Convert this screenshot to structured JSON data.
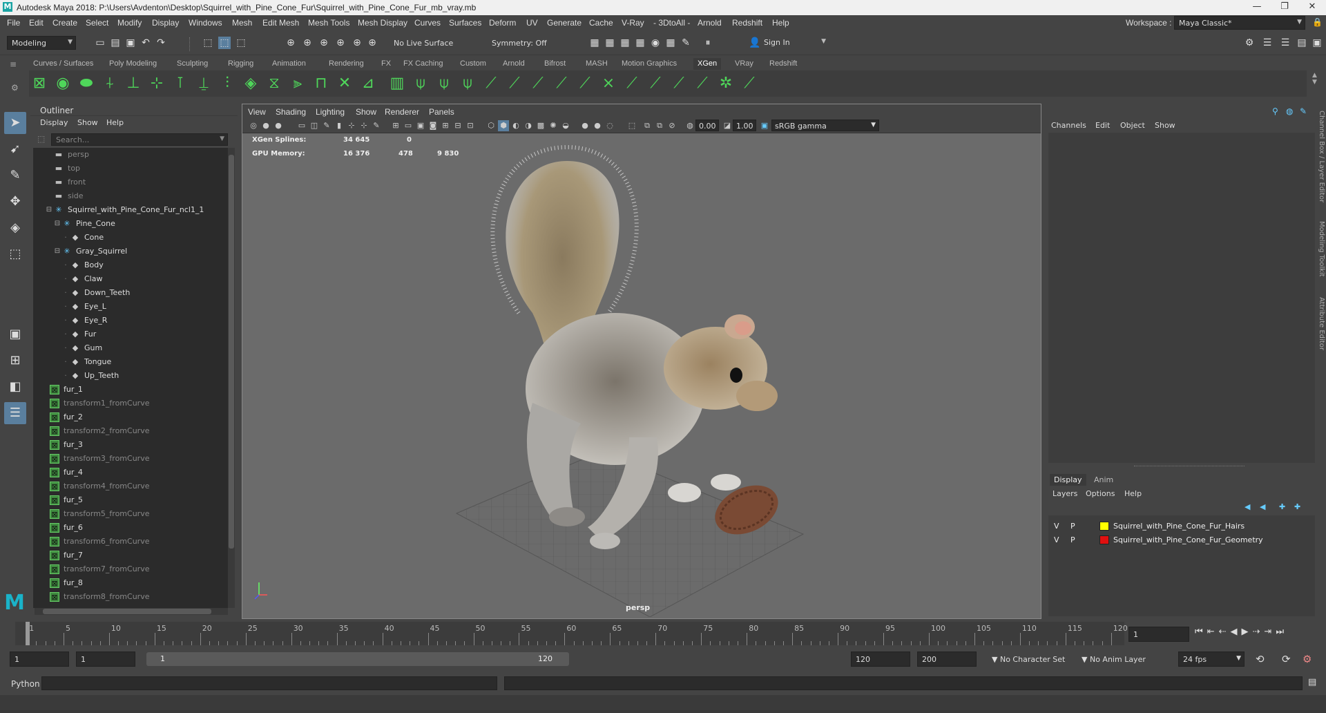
{
  "window": {
    "title": "Autodesk Maya 2018: P:\\Users\\Avdenton\\Desktop\\Squirrel_with_Pine_Cone_Fur\\Squirrel_with_Pine_Cone_Fur_mb_vray.mb",
    "logo": "M",
    "controls": {
      "minimize": "—",
      "maximize": "❐",
      "close": "✕"
    }
  },
  "menubar": {
    "items": [
      "File",
      "Edit",
      "Create",
      "Select",
      "Modify",
      "Display",
      "Windows",
      "Mesh",
      "Edit Mesh",
      "Mesh Tools",
      "Mesh Display",
      "Curves",
      "Surfaces",
      "Deform",
      "UV",
      "Generate",
      "Cache",
      "V-Ray",
      "- 3DtoAll -",
      "Arnold",
      "Redshift",
      "Help"
    ],
    "workspace_label": "Workspace :",
    "workspace_value": "Maya Classic*"
  },
  "statusline": {
    "menuset": "Modeling",
    "live_surface": "No Live Surface",
    "symmetry": "Symmetry: Off",
    "sign_in": "Sign In"
  },
  "shelf": {
    "tabs": [
      "Curves / Surfaces",
      "Poly Modeling",
      "Sculpting",
      "Rigging",
      "Animation",
      "Rendering",
      "FX",
      "FX Caching",
      "Custom",
      "Arnold",
      "Bifrost",
      "MASH",
      "Motion Graphics",
      "XGen",
      "VRay",
      "Redshift"
    ],
    "active_tab": "XGen",
    "icons": [
      "xgen-create-icon",
      "xgen-editor-icon",
      "xgen-sphere-icon",
      "place-guides-icon",
      "guide-add-icon",
      "guide-length-icon",
      "guide-tube-icon",
      "guide-lock-icon",
      "guide-sculpt-icon",
      "guide-layers-icon",
      "guide-bend-icon",
      "guide-clump-icon",
      "guide-cut-icon",
      "guide-smooth-icon",
      "guide-move-icon",
      "xgen-preview-icon",
      "interactive-groom-icon",
      "groom-place-icon",
      "groom-length-icon",
      "groom-comb-icon",
      "groom-grab-icon",
      "groom-cut-icon",
      "groom-smooth-icon",
      "groom-noise-icon",
      "groom-part-icon",
      "groom-clump-icon",
      "groom-freeze-icon",
      "groom-select-icon",
      "groom-density-icon",
      "groom-width-icon",
      "groom-mask-icon"
    ]
  },
  "outliner": {
    "title": "Outliner",
    "menus": [
      "Display",
      "Show",
      "Help"
    ],
    "search_placeholder": "Search...",
    "items": [
      {
        "label": "persp",
        "depth": 0,
        "type": "camera",
        "dim": true
      },
      {
        "label": "top",
        "depth": 0,
        "type": "camera",
        "dim": true
      },
      {
        "label": "front",
        "depth": 0,
        "type": "camera",
        "dim": true
      },
      {
        "label": "side",
        "depth": 0,
        "type": "camera",
        "dim": true
      },
      {
        "label": "Squirrel_with_Pine_Cone_Fur_ncl1_1",
        "depth": 0,
        "type": "group",
        "expand": "−"
      },
      {
        "label": "Pine_Cone",
        "depth": 1,
        "type": "group",
        "expand": "−"
      },
      {
        "label": "Cone",
        "depth": 2,
        "type": "mesh"
      },
      {
        "label": "Gray_Squirrel",
        "depth": 1,
        "type": "group",
        "expand": "−"
      },
      {
        "label": "Body",
        "depth": 2,
        "type": "mesh"
      },
      {
        "label": "Claw",
        "depth": 2,
        "type": "mesh"
      },
      {
        "label": "Down_Teeth",
        "depth": 2,
        "type": "mesh"
      },
      {
        "label": "Eye_L",
        "depth": 2,
        "type": "mesh"
      },
      {
        "label": "Eye_R",
        "depth": 2,
        "type": "mesh"
      },
      {
        "label": "Fur",
        "depth": 2,
        "type": "mesh"
      },
      {
        "label": "Gum",
        "depth": 2,
        "type": "mesh"
      },
      {
        "label": "Tongue",
        "depth": 2,
        "type": "mesh"
      },
      {
        "label": "Up_Teeth",
        "depth": 2,
        "type": "mesh"
      },
      {
        "label": "fur_1",
        "depth": 0,
        "type": "xgen"
      },
      {
        "label": "transform1_fromCurve",
        "depth": 0,
        "type": "xgen",
        "dim": true
      },
      {
        "label": "fur_2",
        "depth": 0,
        "type": "xgen"
      },
      {
        "label": "transform2_fromCurve",
        "depth": 0,
        "type": "xgen",
        "dim": true
      },
      {
        "label": "fur_3",
        "depth": 0,
        "type": "xgen"
      },
      {
        "label": "transform3_fromCurve",
        "depth": 0,
        "type": "xgen",
        "dim": true
      },
      {
        "label": "fur_4",
        "depth": 0,
        "type": "xgen"
      },
      {
        "label": "transform4_fromCurve",
        "depth": 0,
        "type": "xgen",
        "dim": true
      },
      {
        "label": "fur_5",
        "depth": 0,
        "type": "xgen"
      },
      {
        "label": "transform5_fromCurve",
        "depth": 0,
        "type": "xgen",
        "dim": true
      },
      {
        "label": "fur_6",
        "depth": 0,
        "type": "xgen"
      },
      {
        "label": "transform6_fromCurve",
        "depth": 0,
        "type": "xgen",
        "dim": true
      },
      {
        "label": "fur_7",
        "depth": 0,
        "type": "xgen"
      },
      {
        "label": "transform7_fromCurve",
        "depth": 0,
        "type": "xgen",
        "dim": true
      },
      {
        "label": "fur_8",
        "depth": 0,
        "type": "xgen"
      },
      {
        "label": "transform8_fromCurve",
        "depth": 0,
        "type": "xgen",
        "dim": true
      }
    ]
  },
  "viewport": {
    "menus": [
      "View",
      "Shading",
      "Lighting",
      "Show",
      "Renderer",
      "Panels"
    ],
    "exposure": "0.00",
    "gamma": "1.00",
    "color_space": "sRGB gamma",
    "hud": {
      "xgen_splines_label": "XGen Splines:",
      "xgen_splines_values": [
        "34 645",
        "0"
      ],
      "gpu_memory_label": "GPU Memory:",
      "gpu_memory_values": [
        "16 376",
        "478",
        "9 830"
      ]
    },
    "camera_label": "persp"
  },
  "channelbox": {
    "menus": [
      "Channels",
      "Edit",
      "Object",
      "Show"
    ],
    "layer_tabs": [
      "Display",
      "Anim"
    ],
    "layer_menus": [
      "Layers",
      "Options",
      "Help"
    ],
    "layers": [
      {
        "v": "V",
        "p": "P",
        "name": "Squirrel_with_Pine_Cone_Fur_Hairs",
        "color": "#ffff00"
      },
      {
        "v": "V",
        "p": "P",
        "name": "Squirrel_with_Pine_Cone_Fur_Geometry",
        "color": "#e01010"
      }
    ],
    "side_tabs": [
      "Channel Box / Layer Editor",
      "Modeling Toolkit",
      "Attribute Editor"
    ]
  },
  "timeline": {
    "ticks": [
      "1",
      "5",
      "10",
      "15",
      "20",
      "25",
      "30",
      "35",
      "40",
      "45",
      "50",
      "55",
      "60",
      "65",
      "70",
      "75",
      "80",
      "85",
      "90",
      "95",
      "100",
      "105",
      "110",
      "115",
      "120"
    ],
    "current_frame": "1"
  },
  "range": {
    "start": "1",
    "playback_start": "1",
    "slider_start": "1",
    "slider_end": "120",
    "playback_end": "120",
    "end": "200",
    "character_set": "No Character Set",
    "anim_layer": "No Anim Layer",
    "fps": "24 fps"
  },
  "cmdline": {
    "label": "Python"
  },
  "colors": {
    "accent": "#5a7f9e",
    "shelf_icon": "#4fd65a",
    "xgen_icon": "#3f8a3f"
  }
}
